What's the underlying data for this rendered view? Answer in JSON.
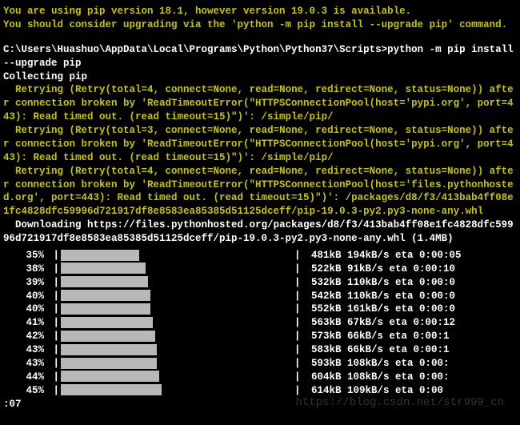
{
  "warning": {
    "line1": "You are using pip version 18.1, however version 19.0.3 is available.",
    "line2": "You should consider upgrading via the 'python -m pip install --upgrade pip' command."
  },
  "prompt": {
    "path": "C:\\Users\\Huashuo\\AppData\\Local\\Programs\\Python\\Python37\\Scripts>",
    "cmd": "python -m pip install --upgrade pip"
  },
  "collecting": "Collecting pip",
  "retries": [
    "  Retrying (Retry(total=4, connect=None, read=None, redirect=None, status=None)) after connection broken by 'ReadTimeoutError(\"HTTPSConnectionPool(host='pypi.org', port=443): Read timed out. (read timeout=15)\")': /simple/pip/",
    "  Retrying (Retry(total=3, connect=None, read=None, redirect=None, status=None)) after connection broken by 'ReadTimeoutError(\"HTTPSConnectionPool(host='pypi.org', port=443): Read timed out. (read timeout=15)\")': /simple/pip/",
    "  Retrying (Retry(total=4, connect=None, read=None, redirect=None, status=None)) after connection broken by 'ReadTimeoutError(\"HTTPSConnectionPool(host='files.pythonhosted.org', port=443): Read timed out. (read timeout=15)\")': /packages/d8/f3/413bab4ff08e1fc4828dfc59996d721917df8e8583ea85385d51125dceff/pip-19.0.3-py2.py3-none-any.whl"
  ],
  "downloading": "  Downloading https://files.pythonhosted.org/packages/d8/f3/413bab4ff08e1fc4828dfc59996d721917df8e8583ea85385d51125dceff/pip-19.0.3-py2.py3-none-any.whl (1.4MB)",
  "progress": [
    {
      "pct": "35%",
      "fill": 35,
      "stats": "481kB 194kB/s eta 0:00:05"
    },
    {
      "pct": "38%",
      "fill": 38,
      "stats": "522kB 91kB/s eta 0:00:10"
    },
    {
      "pct": "39%",
      "fill": 39,
      "stats": "532kB 110kB/s eta 0:00:0"
    },
    {
      "pct": "40%",
      "fill": 40,
      "stats": "542kB 110kB/s eta 0:00:0"
    },
    {
      "pct": "40%",
      "fill": 40,
      "stats": "552kB 161kB/s eta 0:00:0"
    },
    {
      "pct": "41%",
      "fill": 41,
      "stats": "563kB 67kB/s eta 0:00:12"
    },
    {
      "pct": "42%",
      "fill": 42,
      "stats": "573kB 66kB/s eta 0:00:1"
    },
    {
      "pct": "43%",
      "fill": 43,
      "stats": "583kB 66kB/s eta 0:00:1"
    },
    {
      "pct": "43%",
      "fill": 43,
      "stats": "593kB 108kB/s eta 0:00:"
    },
    {
      "pct": "44%",
      "fill": 44,
      "stats": "604kB 108kB/s eta 0:00:"
    },
    {
      "pct": "45%",
      "fill": 45,
      "stats": "614kB 109kB/s eta 0:00"
    }
  ],
  "trailing": ":07",
  "watermark": "https://blog.csdn.net/str999_cn"
}
